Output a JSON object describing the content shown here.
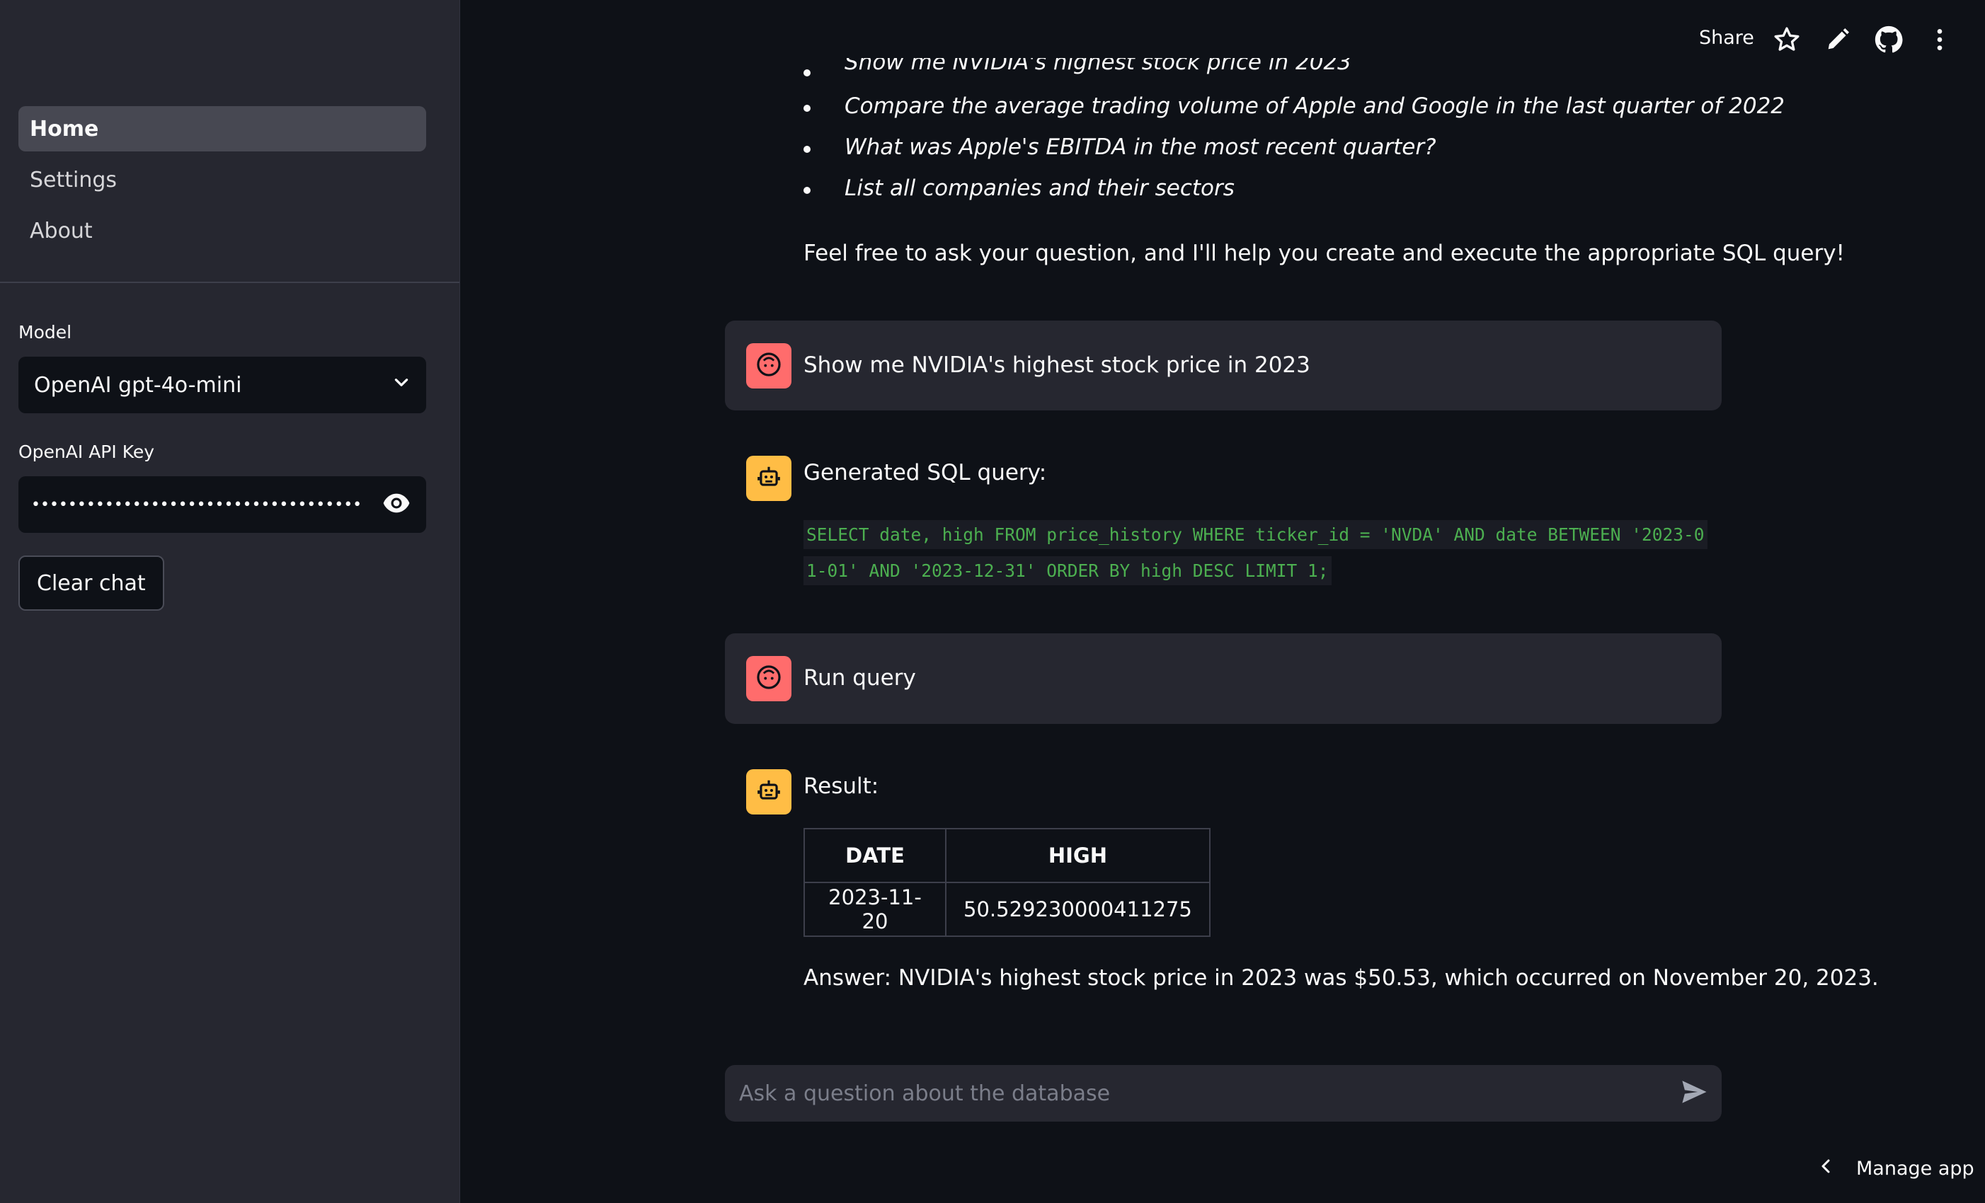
{
  "sidebar": {
    "nav": [
      {
        "label": "Home",
        "active": true
      },
      {
        "label": "Settings",
        "active": false
      },
      {
        "label": "About",
        "active": false
      }
    ],
    "model_label": "Model",
    "model_value": "OpenAI gpt-4o-mini",
    "api_key_label": "OpenAI API Key",
    "api_key_masked": "•••••••••••••••••••••••••••••••••••••••••••••••••••",
    "clear_button": "Clear chat"
  },
  "header": {
    "share": "Share",
    "icons": [
      "star-icon",
      "pencil-icon",
      "github-icon",
      "more-vertical-icon"
    ]
  },
  "chat": {
    "examples": [
      "Show me NVIDIA's highest stock price in 2023",
      "Compare the average trading volume of Apple and Google in the last quarter of 2022",
      "What was Apple's EBITDA in the most recent quarter?",
      "List all companies and their sectors"
    ],
    "intro_closing": "Feel free to ask your question, and I'll help you create and execute the appropriate SQL query!",
    "messages": [
      {
        "role": "user",
        "text": "Show me NVIDIA's highest stock price in 2023"
      },
      {
        "role": "assistant",
        "text": "Generated SQL query:",
        "code": "SELECT date, high FROM price_history WHERE ticker_id = 'NVDA' AND date BETWEEN '2023-01-01' AND '2023-12-31' ORDER BY high DESC LIMIT 1;"
      },
      {
        "role": "user",
        "text": "Run query"
      },
      {
        "role": "assistant",
        "text": "Result:",
        "table": {
          "columns": [
            "DATE",
            "HIGH"
          ],
          "rows": [
            [
              "2023-11-20",
              "50.529230000411275"
            ]
          ]
        },
        "answer": "Answer: NVIDIA's highest stock price in 2023 was $50.53, which occurred on November 20, 2023."
      }
    ],
    "input_placeholder": "Ask a question about the database"
  },
  "footer": {
    "manage_app": "Manage app"
  },
  "colors": {
    "user_avatar": "#ff6c6c",
    "bot_avatar": "#ffbd45",
    "code_text": "#4caf50",
    "background": "#0e1117",
    "sidebar": "#262730"
  }
}
